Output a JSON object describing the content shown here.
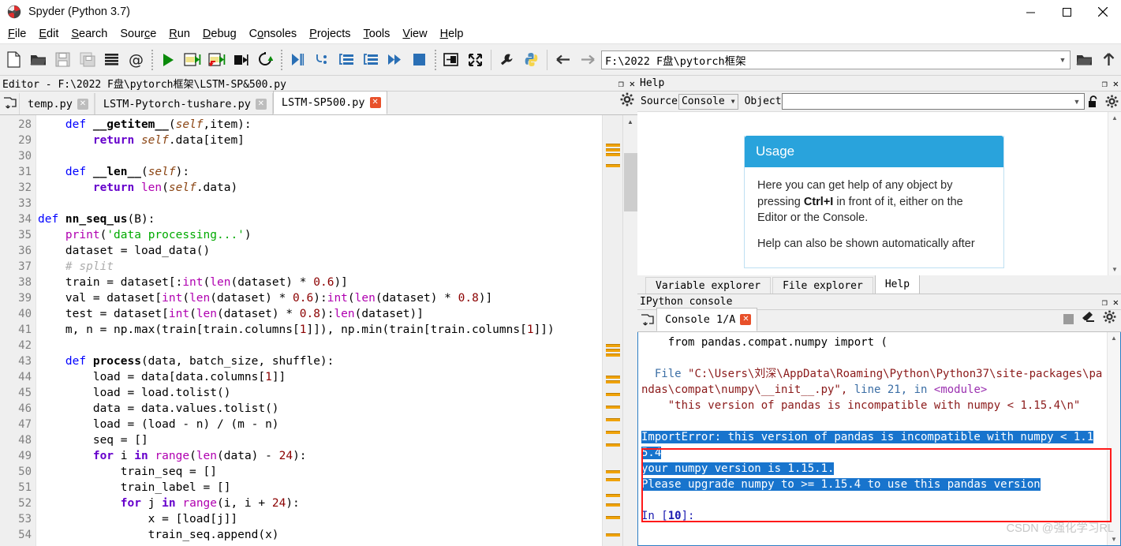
{
  "window": {
    "title": "Spyder (Python 3.7)",
    "app_icon": "spyder-logo-icon",
    "minimize": "—",
    "maximize": "□",
    "close": "✕"
  },
  "menubar": {
    "items": [
      {
        "label": "File",
        "accel": "F"
      },
      {
        "label": "Edit",
        "accel": "E"
      },
      {
        "label": "Search",
        "accel": "S"
      },
      {
        "label": "Source",
        "accel": "c"
      },
      {
        "label": "Run",
        "accel": "R"
      },
      {
        "label": "Debug",
        "accel": "D"
      },
      {
        "label": "Consoles",
        "accel": "o"
      },
      {
        "label": "Projects",
        "accel": "P"
      },
      {
        "label": "Tools",
        "accel": "T"
      },
      {
        "label": "View",
        "accel": "V"
      },
      {
        "label": "Help",
        "accel": "H"
      }
    ]
  },
  "toolbar": {
    "buttons": [
      "new-file-icon",
      "open-file-icon",
      "save-file-icon",
      "save-all-icon",
      "file-switcher-icon",
      "find-in-files-icon",
      "run-file-icon",
      "run-cell-icon",
      "run-cell-advance-icon",
      "run-selection-icon",
      "rerun-file-icon",
      "debug-file-icon",
      "debug-step-into-icon",
      "debug-step-over-icon",
      "debug-step-return-icon",
      "debug-continue-icon",
      "debug-stop-icon",
      "maximize-pane-icon",
      "fullscreen-icon",
      "preferences-icon",
      "pythonpath-manager-icon"
    ],
    "nav_back": "←",
    "nav_forward": "→",
    "path_value": "F:\\2022 F盘\\pytorch框架",
    "path_placeholder": "",
    "browse_icon": "open-folder-icon",
    "parent_icon": "up-arrow-icon"
  },
  "editor_pane": {
    "title": "Editor - F:\\2022 F盘\\pytorch框架\\LSTM-SP&500.py",
    "undock_icon": "❐",
    "close_icon": "✕",
    "browse_tabs_icon": "browse-tabs-icon",
    "options_icon": "options-gear-icon",
    "tabs": [
      {
        "label": "temp.py",
        "active": false,
        "modified": false
      },
      {
        "label": "LSTM-Pytorch-tushare.py",
        "active": false,
        "modified": false
      },
      {
        "label": "LSTM-SP500.py",
        "active": true,
        "modified": true
      }
    ],
    "first_line_number": 28,
    "lines": [
      {
        "n": 28,
        "tokens": [
          {
            "t": "    ",
            "c": ""
          },
          {
            "t": "def ",
            "c": "kw"
          },
          {
            "t": "__getitem__",
            "c": "fn"
          },
          {
            "t": "(",
            "c": ""
          },
          {
            "t": "self",
            "c": "slf"
          },
          {
            "t": ",item):",
            "c": ""
          }
        ]
      },
      {
        "n": 29,
        "tokens": [
          {
            "t": "        ",
            "c": ""
          },
          {
            "t": "return ",
            "c": "kw2"
          },
          {
            "t": "self",
            "c": "slf"
          },
          {
            "t": ".data[item]",
            "c": ""
          }
        ]
      },
      {
        "n": 30,
        "tokens": []
      },
      {
        "n": 31,
        "tokens": [
          {
            "t": "    ",
            "c": ""
          },
          {
            "t": "def ",
            "c": "kw"
          },
          {
            "t": "__len__",
            "c": "fn"
          },
          {
            "t": "(",
            "c": ""
          },
          {
            "t": "self",
            "c": "slf"
          },
          {
            "t": "):",
            "c": ""
          }
        ]
      },
      {
        "n": 32,
        "tokens": [
          {
            "t": "        ",
            "c": ""
          },
          {
            "t": "return ",
            "c": "kw2"
          },
          {
            "t": "len",
            "c": "bi"
          },
          {
            "t": "(",
            "c": ""
          },
          {
            "t": "self",
            "c": "slf"
          },
          {
            "t": ".data)",
            "c": ""
          }
        ]
      },
      {
        "n": 33,
        "tokens": []
      },
      {
        "n": 34,
        "tokens": [
          {
            "t": "def ",
            "c": "kw"
          },
          {
            "t": "nn_seq_us",
            "c": "fn"
          },
          {
            "t": "(B):",
            "c": ""
          }
        ]
      },
      {
        "n": 35,
        "tokens": [
          {
            "t": "    ",
            "c": ""
          },
          {
            "t": "print",
            "c": "bi"
          },
          {
            "t": "(",
            "c": ""
          },
          {
            "t": "'data processing...'",
            "c": "str"
          },
          {
            "t": ")",
            "c": ""
          }
        ]
      },
      {
        "n": 36,
        "tokens": [
          {
            "t": "    dataset = load_data()",
            "c": ""
          }
        ]
      },
      {
        "n": 37,
        "tokens": [
          {
            "t": "    ",
            "c": ""
          },
          {
            "t": "# split",
            "c": "cmt"
          }
        ]
      },
      {
        "n": 38,
        "tokens": [
          {
            "t": "    train = dataset[:",
            "c": ""
          },
          {
            "t": "int",
            "c": "bi"
          },
          {
            "t": "(",
            "c": ""
          },
          {
            "t": "len",
            "c": "bi"
          },
          {
            "t": "(dataset) * ",
            "c": ""
          },
          {
            "t": "0.6",
            "c": "num"
          },
          {
            "t": ")]",
            "c": ""
          }
        ]
      },
      {
        "n": 39,
        "tokens": [
          {
            "t": "    val = dataset[",
            "c": ""
          },
          {
            "t": "int",
            "c": "bi"
          },
          {
            "t": "(",
            "c": ""
          },
          {
            "t": "len",
            "c": "bi"
          },
          {
            "t": "(dataset) * ",
            "c": ""
          },
          {
            "t": "0.6",
            "c": "num"
          },
          {
            "t": "):",
            "c": ""
          },
          {
            "t": "int",
            "c": "bi"
          },
          {
            "t": "(",
            "c": ""
          },
          {
            "t": "len",
            "c": "bi"
          },
          {
            "t": "(dataset) * ",
            "c": ""
          },
          {
            "t": "0.8",
            "c": "num"
          },
          {
            "t": ")]",
            "c": ""
          }
        ]
      },
      {
        "n": 40,
        "tokens": [
          {
            "t": "    test = dataset[",
            "c": ""
          },
          {
            "t": "int",
            "c": "bi"
          },
          {
            "t": "(",
            "c": ""
          },
          {
            "t": "len",
            "c": "bi"
          },
          {
            "t": "(dataset) * ",
            "c": ""
          },
          {
            "t": "0.8",
            "c": "num"
          },
          {
            "t": "):",
            "c": ""
          },
          {
            "t": "len",
            "c": "bi"
          },
          {
            "t": "(dataset)]",
            "c": ""
          }
        ]
      },
      {
        "n": 41,
        "tokens": [
          {
            "t": "    m, n = np.max(train[train.columns[",
            "c": ""
          },
          {
            "t": "1",
            "c": "num"
          },
          {
            "t": "]]), np.min(train[train.columns[",
            "c": ""
          },
          {
            "t": "1",
            "c": "num"
          },
          {
            "t": "]])",
            "c": ""
          }
        ]
      },
      {
        "n": 42,
        "tokens": []
      },
      {
        "n": 43,
        "tokens": [
          {
            "t": "    ",
            "c": ""
          },
          {
            "t": "def ",
            "c": "kw"
          },
          {
            "t": "process",
            "c": "fn"
          },
          {
            "t": "(data, batch_size, shuffle):",
            "c": ""
          }
        ]
      },
      {
        "n": 44,
        "tokens": [
          {
            "t": "        load = data[data.columns[",
            "c": ""
          },
          {
            "t": "1",
            "c": "num"
          },
          {
            "t": "]]",
            "c": ""
          }
        ]
      },
      {
        "n": 45,
        "tokens": [
          {
            "t": "        load = load.tolist()",
            "c": ""
          }
        ]
      },
      {
        "n": 46,
        "tokens": [
          {
            "t": "        data = data.values.tolist()",
            "c": ""
          }
        ]
      },
      {
        "n": 47,
        "tokens": [
          {
            "t": "        load = (load - n) / (m - n)",
            "c": ""
          }
        ]
      },
      {
        "n": 48,
        "tokens": [
          {
            "t": "        seq = []",
            "c": ""
          }
        ]
      },
      {
        "n": 49,
        "tokens": [
          {
            "t": "        ",
            "c": ""
          },
          {
            "t": "for ",
            "c": "kw2"
          },
          {
            "t": "i ",
            "c": ""
          },
          {
            "t": "in ",
            "c": "kw2"
          },
          {
            "t": "range",
            "c": "bi"
          },
          {
            "t": "(",
            "c": ""
          },
          {
            "t": "len",
            "c": "bi"
          },
          {
            "t": "(data) - ",
            "c": ""
          },
          {
            "t": "24",
            "c": "num"
          },
          {
            "t": "):",
            "c": ""
          }
        ]
      },
      {
        "n": 50,
        "tokens": [
          {
            "t": "            train_seq = []",
            "c": ""
          }
        ]
      },
      {
        "n": 51,
        "tokens": [
          {
            "t": "            train_label = []",
            "c": ""
          }
        ]
      },
      {
        "n": 52,
        "tokens": [
          {
            "t": "            ",
            "c": ""
          },
          {
            "t": "for ",
            "c": "kw2"
          },
          {
            "t": "j ",
            "c": ""
          },
          {
            "t": "in ",
            "c": "kw2"
          },
          {
            "t": "range",
            "c": "bi"
          },
          {
            "t": "(i, i + ",
            "c": ""
          },
          {
            "t": "24",
            "c": "num"
          },
          {
            "t": "):",
            "c": ""
          }
        ]
      },
      {
        "n": 53,
        "tokens": [
          {
            "t": "                x = [load[j]]",
            "c": ""
          }
        ]
      },
      {
        "n": 54,
        "tokens": [
          {
            "t": "                train_seq.append(x)",
            "c": ""
          }
        ]
      }
    ]
  },
  "help_pane": {
    "title": "Help",
    "undock_icon": "❐",
    "close_icon": "✕",
    "source_label": "Source",
    "source_value": "Console",
    "object_label": "Object",
    "object_value": "",
    "object_placeholder": "",
    "lock_icon": "unlock-icon",
    "options_icon": "options-gear-icon",
    "usage": {
      "heading": "Usage",
      "paragraph1_pre": "Here you can get help of any object by pressing ",
      "paragraph1_bold": "Ctrl+I",
      "paragraph1_post": " in front of it, either on the Editor or the Console.",
      "paragraph2": "Help can also be shown automatically after"
    },
    "bottom_tabs": [
      {
        "label": "Variable explorer",
        "active": false
      },
      {
        "label": "File explorer",
        "active": false
      },
      {
        "label": "Help",
        "active": true
      }
    ]
  },
  "console_pane": {
    "title": "IPython console",
    "undock_icon": "❐",
    "close_icon": "✕",
    "browse_icon": "browse-tabs-icon",
    "tab_label": "Console 1/A",
    "tab_close": "✕",
    "interrupt_icon": "stop-kernel-icon",
    "clear_icon": "clear-console-icon",
    "options_icon": "options-gear-icon",
    "output": {
      "line1": "    from pandas.compat.numpy import (",
      "line2_kw": "  File ",
      "line2_path": "\"C:\\Users\\刘深\\AppData\\Roaming\\Python\\Python37\\site-packages\\pandas\\compat\\numpy\\__init__.py\", ",
      "line2_linelbl": "line ",
      "line2_lineno": "21",
      "line2_in": ", in ",
      "line2_module": "<module>",
      "line3": "    \"this version of pandas is incompatible with numpy < 1.15.4\\n\"",
      "selected_line1": "ImportError: this version of pandas is incompatible with numpy < 1.15.4",
      "selected_line2": "your numpy version is 1.15.1.",
      "selected_line3": "Please upgrade numpy to >= 1.15.4 to use this pandas version",
      "prompt_pre": "In [",
      "prompt_num": "10",
      "prompt_post": "]:"
    },
    "error_highlight_color": "#ff1a1a",
    "selection_color": "#1874cd"
  },
  "watermark": "CSDN @强化学习RL"
}
